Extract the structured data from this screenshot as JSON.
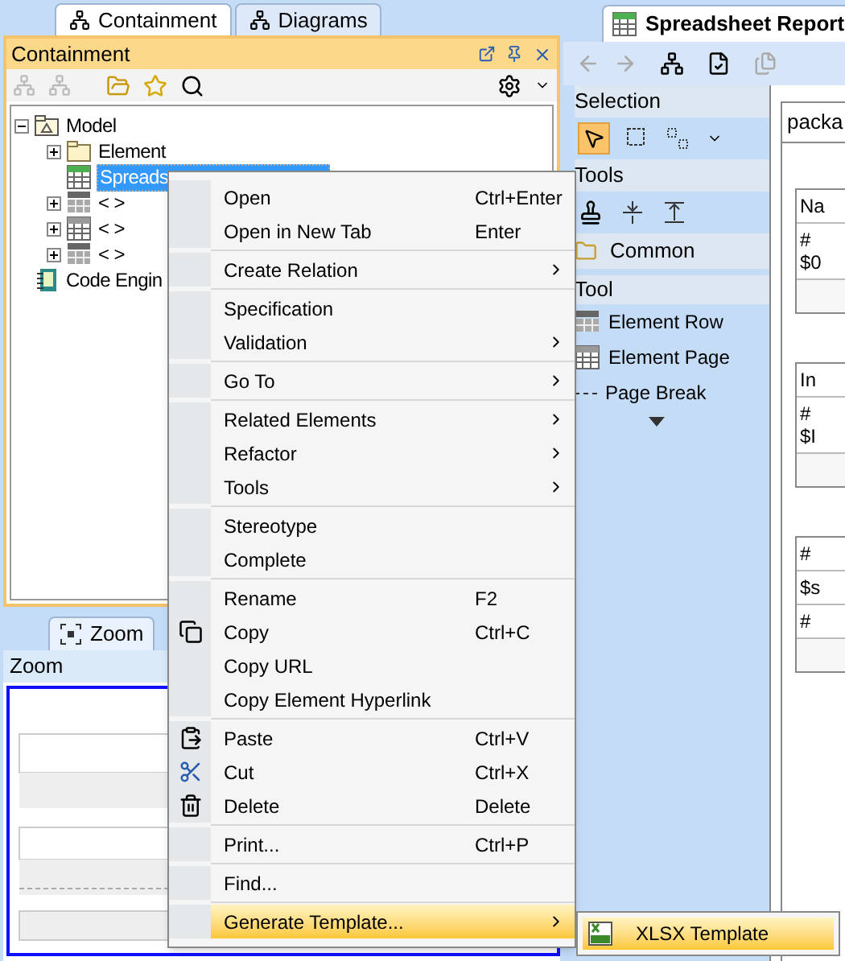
{
  "left_tabs": [
    {
      "label": "Containment",
      "selected": true
    },
    {
      "label": "Diagrams",
      "selected": false
    }
  ],
  "containment": {
    "title": "Containment",
    "tree": [
      {
        "label": "Model",
        "kind": "package",
        "expanded": true,
        "selected": false,
        "children": [
          {
            "label": "Element",
            "kind": "folder",
            "expanded": false,
            "selected": false
          },
          {
            "label": "Spreads",
            "kind": "sheet",
            "selected": true
          },
          {
            "label": "< >",
            "kind": "row",
            "expanded": false,
            "selected": false
          },
          {
            "label": "< >",
            "kind": "page",
            "expanded": false,
            "selected": false
          },
          {
            "label": "< >",
            "kind": "row",
            "expanded": false,
            "selected": false
          }
        ]
      },
      {
        "label": "Code Engin",
        "kind": "code",
        "selected": false
      }
    ]
  },
  "zoom_tabs": [
    {
      "label": "Zoom",
      "selected": true
    }
  ],
  "zoom": {
    "title": "Zoom"
  },
  "editor_tab": {
    "label": "Spreadsheet Report"
  },
  "palette": {
    "groups": [
      {
        "title": "Selection",
        "kind": "selection"
      },
      {
        "title": "Tools",
        "kind": "tools"
      },
      {
        "title": "Common",
        "kind": "folder"
      },
      {
        "title": "Tool",
        "kind": "items",
        "items": [
          {
            "label": "Element Row",
            "kind": "row"
          },
          {
            "label": "Element Page",
            "kind": "page"
          },
          {
            "label": "Page Break",
            "kind": "break"
          }
        ]
      }
    ]
  },
  "canvas": {
    "tab": "packa",
    "tables": [
      {
        "rows": [
          "Na",
          "#\n$0"
        ]
      },
      {
        "rows": [
          "In",
          "#\n$I"
        ]
      },
      {
        "rows": [
          "#",
          "$s",
          "#"
        ]
      }
    ]
  },
  "context_menu": {
    "groups": [
      [
        {
          "label": "Open",
          "shortcut": "Ctrl+Enter",
          "submenu": false,
          "selected": false
        },
        {
          "label": "Open in New Tab",
          "shortcut": "Enter",
          "submenu": false,
          "selected": false
        }
      ],
      [
        {
          "label": "Create Relation",
          "submenu": true,
          "selected": false
        }
      ],
      [
        {
          "label": "Specification",
          "submenu": false,
          "selected": false
        },
        {
          "label": "Validation",
          "submenu": true,
          "selected": false
        }
      ],
      [
        {
          "label": "Go To",
          "submenu": true,
          "selected": false
        }
      ],
      [
        {
          "label": "Related Elements",
          "submenu": true,
          "selected": false
        },
        {
          "label": "Refactor",
          "submenu": true,
          "selected": false
        },
        {
          "label": "Tools",
          "submenu": true,
          "selected": false
        }
      ],
      [
        {
          "label": "Stereotype",
          "submenu": false,
          "selected": false
        },
        {
          "label": "Complete",
          "submenu": false,
          "selected": false
        }
      ],
      [
        {
          "label": "Rename",
          "shortcut": "F2",
          "submenu": false,
          "selected": false
        },
        {
          "label": "Copy",
          "shortcut": "Ctrl+C",
          "kind": "copy",
          "submenu": false,
          "selected": false
        },
        {
          "label": "Copy URL",
          "submenu": false,
          "selected": false
        },
        {
          "label": "Copy Element Hyperlink",
          "submenu": false,
          "selected": false
        }
      ],
      [
        {
          "label": "Paste",
          "shortcut": "Ctrl+V",
          "kind": "paste",
          "submenu": false,
          "selected": false
        },
        {
          "label": "Cut",
          "shortcut": "Ctrl+X",
          "kind": "cut",
          "submenu": false,
          "selected": false
        },
        {
          "label": "Delete",
          "shortcut": "Delete",
          "kind": "delete",
          "submenu": false,
          "selected": false
        }
      ],
      [
        {
          "label": "Print...",
          "shortcut": "Ctrl+P",
          "submenu": false,
          "selected": false
        }
      ],
      [
        {
          "label": "Find...",
          "submenu": false,
          "selected": false
        }
      ],
      [
        {
          "label": "Generate Template...",
          "submenu": true,
          "selected": true
        }
      ]
    ]
  },
  "submenu": {
    "items": [
      {
        "label": "XLSX Template",
        "selected": true
      }
    ]
  }
}
